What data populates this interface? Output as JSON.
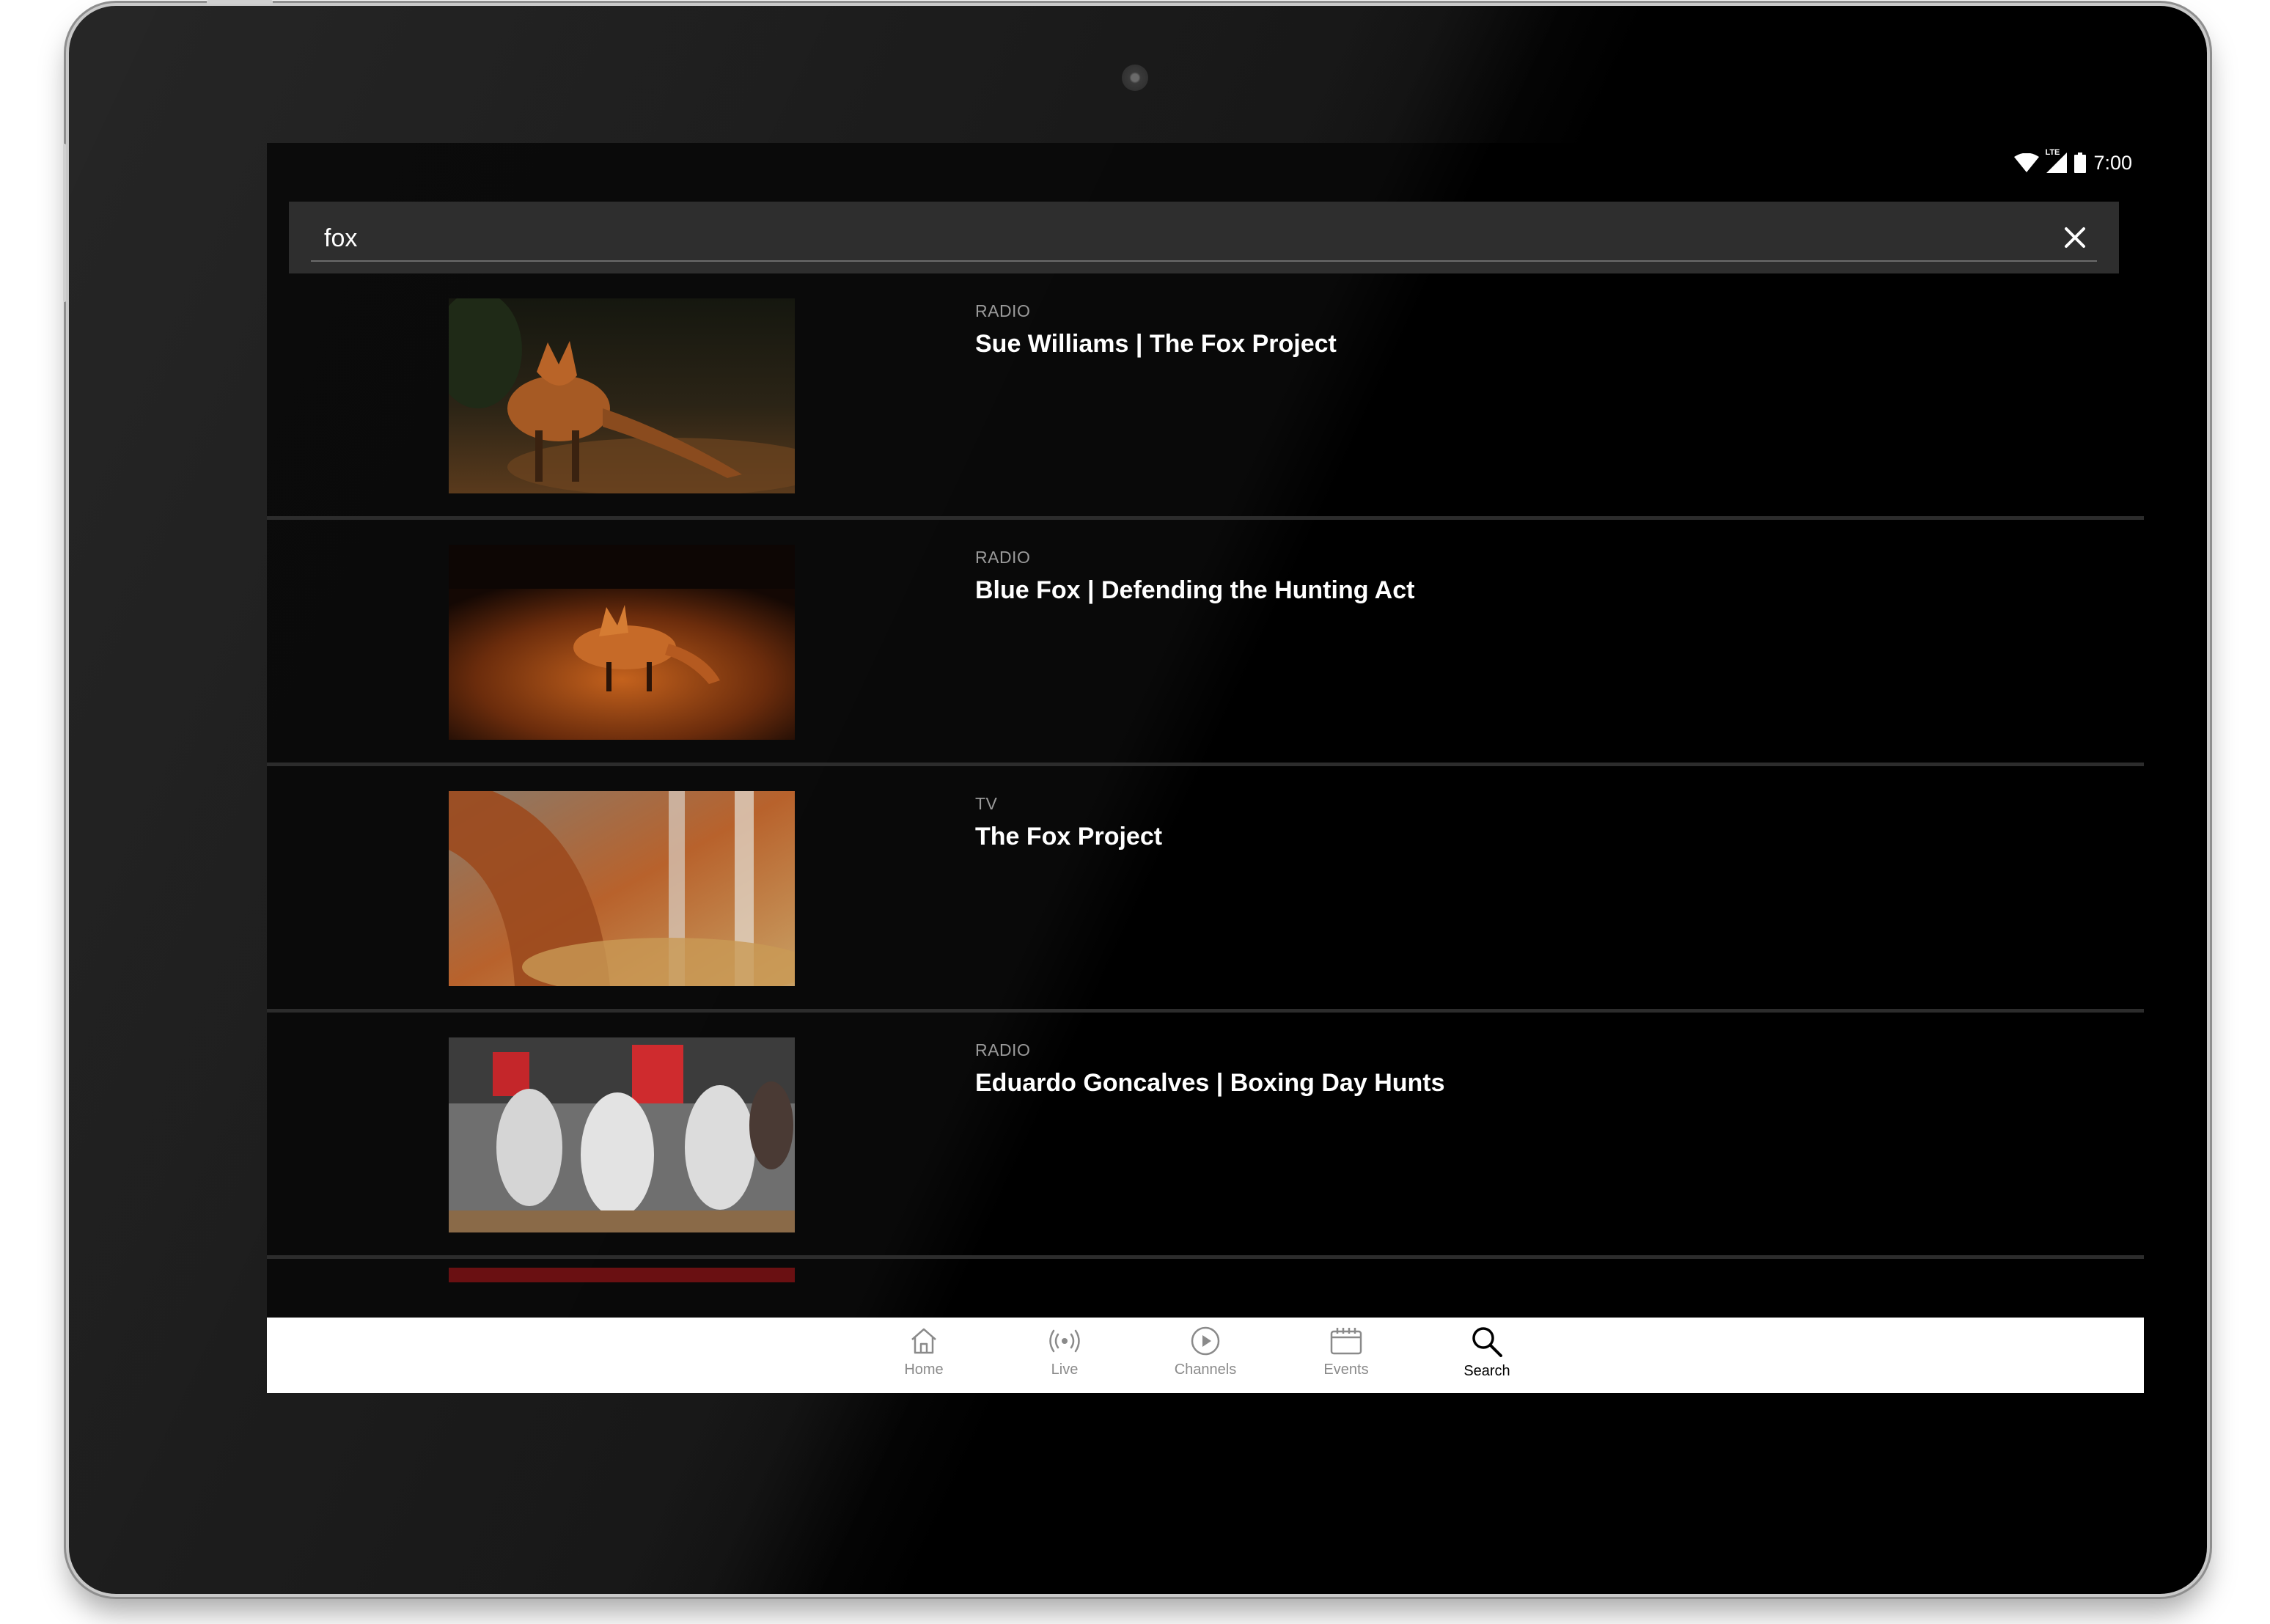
{
  "status_bar": {
    "network_label": "LTE",
    "time": "7:00"
  },
  "search": {
    "query": "fox",
    "clear_icon": "close-icon"
  },
  "results": [
    {
      "category": "RADIO",
      "title": "Sue Williams | The Fox Project"
    },
    {
      "category": "RADIO",
      "title": "Blue Fox | Defending the Hunting Act"
    },
    {
      "category": "TV",
      "title": "The Fox Project"
    },
    {
      "category": "RADIO",
      "title": "Eduardo Goncalves | Boxing Day Hunts"
    }
  ],
  "bottom_nav": {
    "home": {
      "label": "Home",
      "icon": "home-icon"
    },
    "live": {
      "label": "Live",
      "icon": "broadcast-icon"
    },
    "channels": {
      "label": "Channels",
      "icon": "play-circle-icon"
    },
    "events": {
      "label": "Events",
      "icon": "calendar-icon"
    },
    "search": {
      "label": "Search",
      "icon": "search-icon"
    },
    "active": "search"
  },
  "colors": {
    "background": "#000000",
    "search_bar": "#2e2e2e",
    "divider": "#2c2c2c",
    "category_text": "#9a9a9a",
    "nav_inactive": "#8a8a8a",
    "nav_active": "#000000"
  }
}
